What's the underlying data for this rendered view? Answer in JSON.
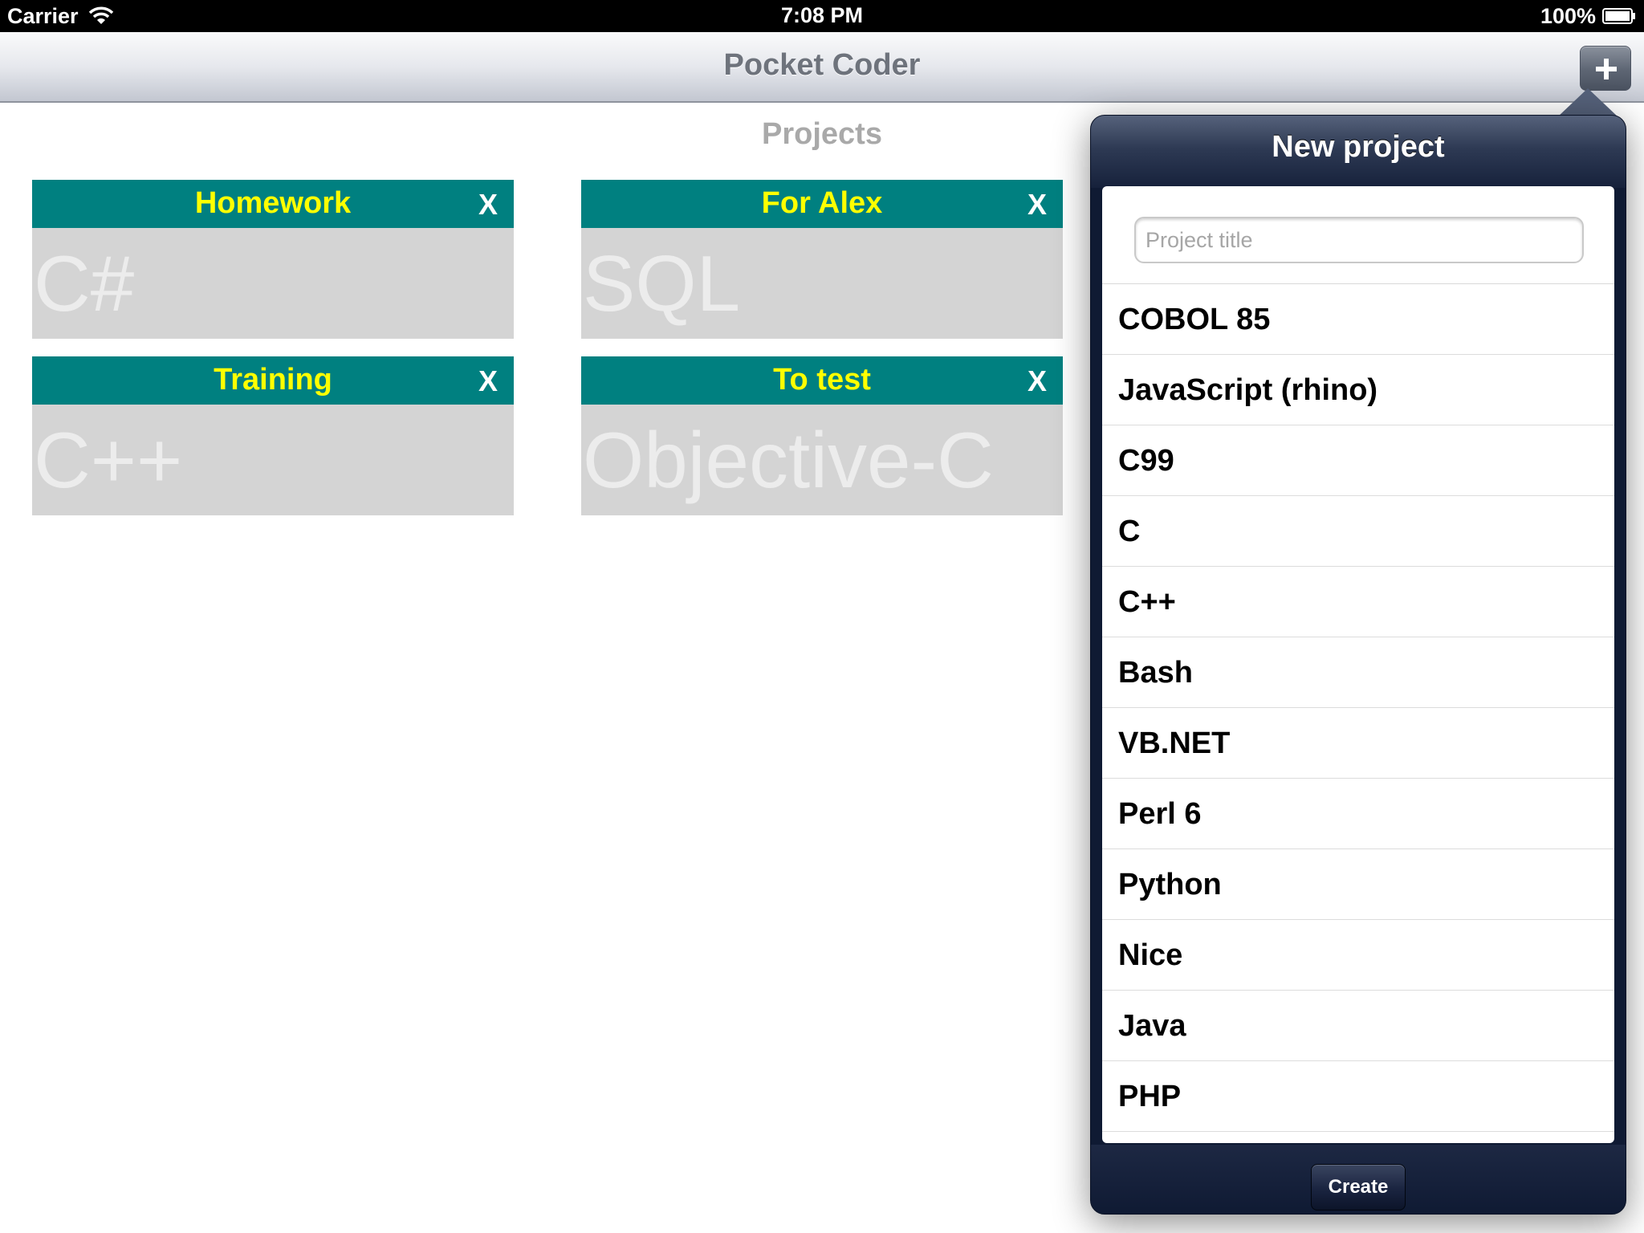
{
  "status_bar": {
    "carrier": "Carrier",
    "time": "7:08 PM",
    "battery": "100%"
  },
  "nav": {
    "title": "Pocket Coder",
    "add_icon": "plus-icon"
  },
  "projects": {
    "section_title": "Projects",
    "close_label": "X",
    "items": [
      {
        "title": "Homework",
        "language": "C#"
      },
      {
        "title": "For Alex",
        "language": "SQL"
      },
      {
        "title": "Training",
        "language": "C++"
      },
      {
        "title": "To test",
        "language": "Objective-C"
      }
    ]
  },
  "popover": {
    "title": "New project",
    "title_placeholder": "Project title",
    "languages": [
      "COBOL 85",
      "JavaScript (rhino)",
      "C99",
      "C",
      "C++",
      "Bash",
      "VB.NET",
      "Perl 6",
      "Python",
      "Nice",
      "Java",
      "PHP"
    ],
    "create_label": "Create"
  },
  "colors": {
    "card_header": "#008080",
    "card_title": "#ffff00",
    "card_body": "#d4d4d4",
    "popover_bg": "#0f1a33"
  }
}
